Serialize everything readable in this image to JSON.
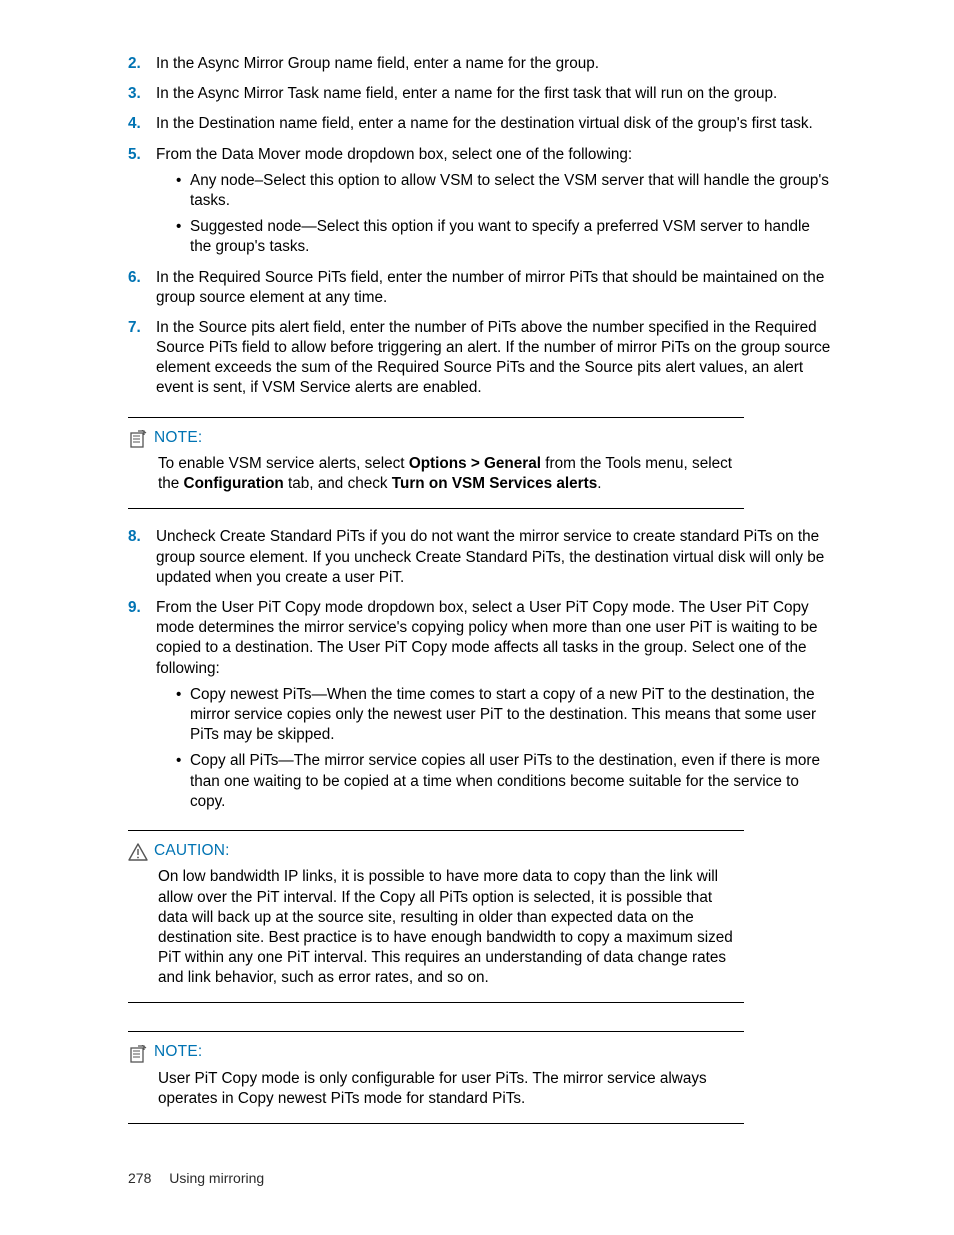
{
  "steps": {
    "s2": {
      "num": "2.",
      "text": "In the Async Mirror Group name field, enter a name for the group."
    },
    "s3": {
      "num": "3.",
      "text": "In the Async Mirror Task name field, enter a name for the first task that will run on the group."
    },
    "s4": {
      "num": "4.",
      "text": "In the Destination name field, enter a name for the destination virtual disk of the group's first task."
    },
    "s5": {
      "num": "5.",
      "text": "From the Data Mover mode dropdown box, select one of the following:",
      "bullets": [
        "Any node–Select this option to allow VSM to select the VSM server that will handle the group's tasks.",
        "Suggested node—Select this option if you want to specify a preferred VSM server to handle the group's tasks."
      ]
    },
    "s6": {
      "num": "6.",
      "text": "In the Required Source PiTs field, enter the number of mirror PiTs that should be maintained on the group source element at any time."
    },
    "s7": {
      "num": "7.",
      "text": "In the Source pits alert field, enter the number of PiTs above the number specified in the Required Source PiTs field to allow before triggering an alert. If the number of mirror PiTs on the group source element exceeds the sum of the Required Source PiTs and the Source pits alert values, an alert event is sent, if VSM Service alerts are enabled."
    },
    "s8": {
      "num": "8.",
      "text": "Uncheck Create Standard PiTs if you do not want the mirror service to create standard PiTs on the group source element. If you uncheck Create Standard PiTs, the destination virtual disk will only be updated when you create a user PiT."
    },
    "s9": {
      "num": "9.",
      "text": "From the User PiT Copy mode dropdown box, select a User PiT Copy mode. The User PiT Copy mode determines the mirror service's copying policy when more than one user PiT is waiting to be copied to a destination. The User PiT Copy mode affects all tasks in the group. Select one of the following:",
      "bullets": [
        "Copy newest PiTs—When the time comes to start a copy of a new PiT to the destination, the mirror service copies only the newest user PiT to the destination. This means that some user PiTs may be skipped.",
        "Copy all PiTs—The mirror service copies all user PiTs to the destination, even if there is more than one waiting to be copied at a time when conditions become suitable for the service to copy."
      ]
    }
  },
  "note1": {
    "title": "NOTE:",
    "body_pre": "To enable VSM service alerts, select ",
    "bold1": "Options > General",
    "body_mid1": " from the Tools menu, select the ",
    "bold2": "Configuration",
    "body_mid2": " tab, and check ",
    "bold3": "Turn on VSM Services alerts",
    "body_post": "."
  },
  "caution": {
    "title": "CAUTION:",
    "body": "On low bandwidth IP links, it is possible to have more data to copy than the link will allow over the PiT interval. If the Copy all PiTs option is selected, it is possible that data will back up at the source site, resulting in older than expected data on the destination site. Best practice is to have enough bandwidth to copy a maximum sized PiT within any one PiT interval. This requires an understanding of data change rates and link behavior, such as error rates, and so on."
  },
  "note2": {
    "title": "NOTE:",
    "body": "User PiT Copy mode is only configurable for user PiTs. The mirror service always operates in Copy newest PiTs mode for standard PiTs."
  },
  "footer": {
    "page": "278",
    "section": "Using mirroring"
  }
}
